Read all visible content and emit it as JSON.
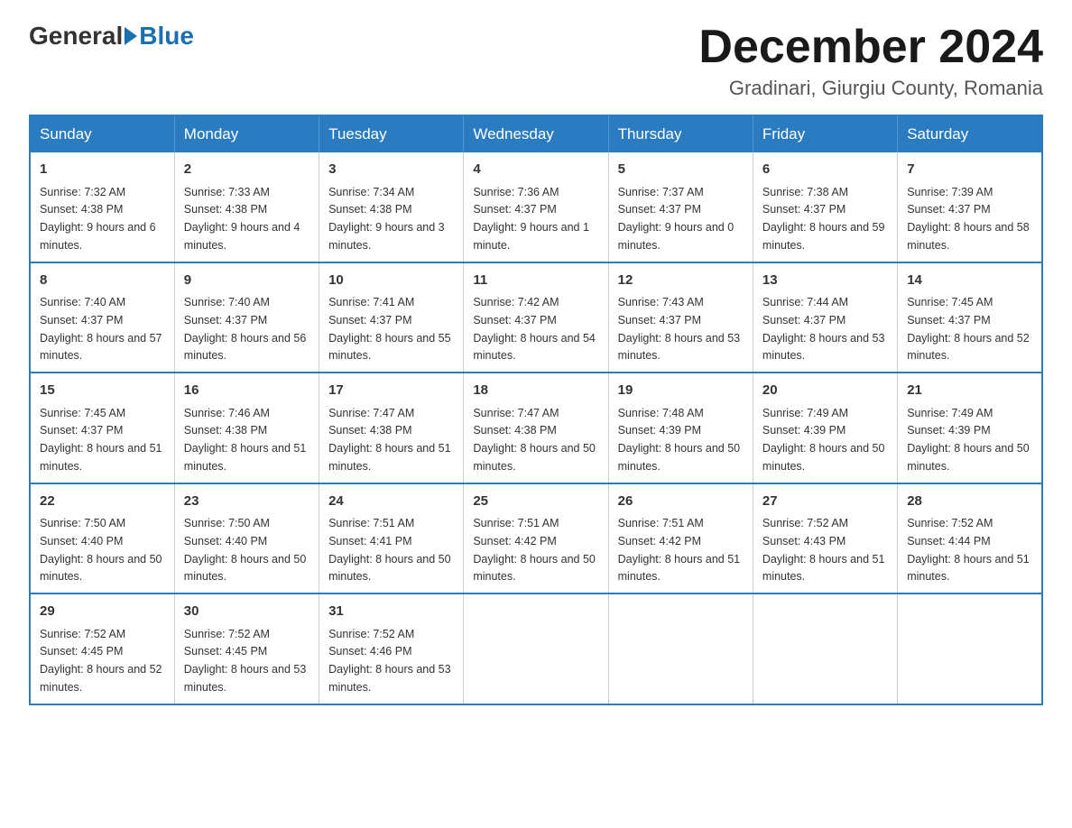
{
  "header": {
    "logo_general": "General",
    "logo_blue": "Blue",
    "month_title": "December 2024",
    "location": "Gradinari, Giurgiu County, Romania"
  },
  "weekdays": [
    "Sunday",
    "Monday",
    "Tuesday",
    "Wednesday",
    "Thursday",
    "Friday",
    "Saturday"
  ],
  "weeks": [
    [
      {
        "day": "1",
        "sunrise": "7:32 AM",
        "sunset": "4:38 PM",
        "daylight": "9 hours and 6 minutes."
      },
      {
        "day": "2",
        "sunrise": "7:33 AM",
        "sunset": "4:38 PM",
        "daylight": "9 hours and 4 minutes."
      },
      {
        "day": "3",
        "sunrise": "7:34 AM",
        "sunset": "4:38 PM",
        "daylight": "9 hours and 3 minutes."
      },
      {
        "day": "4",
        "sunrise": "7:36 AM",
        "sunset": "4:37 PM",
        "daylight": "9 hours and 1 minute."
      },
      {
        "day": "5",
        "sunrise": "7:37 AM",
        "sunset": "4:37 PM",
        "daylight": "9 hours and 0 minutes."
      },
      {
        "day": "6",
        "sunrise": "7:38 AM",
        "sunset": "4:37 PM",
        "daylight": "8 hours and 59 minutes."
      },
      {
        "day": "7",
        "sunrise": "7:39 AM",
        "sunset": "4:37 PM",
        "daylight": "8 hours and 58 minutes."
      }
    ],
    [
      {
        "day": "8",
        "sunrise": "7:40 AM",
        "sunset": "4:37 PM",
        "daylight": "8 hours and 57 minutes."
      },
      {
        "day": "9",
        "sunrise": "7:40 AM",
        "sunset": "4:37 PM",
        "daylight": "8 hours and 56 minutes."
      },
      {
        "day": "10",
        "sunrise": "7:41 AM",
        "sunset": "4:37 PM",
        "daylight": "8 hours and 55 minutes."
      },
      {
        "day": "11",
        "sunrise": "7:42 AM",
        "sunset": "4:37 PM",
        "daylight": "8 hours and 54 minutes."
      },
      {
        "day": "12",
        "sunrise": "7:43 AM",
        "sunset": "4:37 PM",
        "daylight": "8 hours and 53 minutes."
      },
      {
        "day": "13",
        "sunrise": "7:44 AM",
        "sunset": "4:37 PM",
        "daylight": "8 hours and 53 minutes."
      },
      {
        "day": "14",
        "sunrise": "7:45 AM",
        "sunset": "4:37 PM",
        "daylight": "8 hours and 52 minutes."
      }
    ],
    [
      {
        "day": "15",
        "sunrise": "7:45 AM",
        "sunset": "4:37 PM",
        "daylight": "8 hours and 51 minutes."
      },
      {
        "day": "16",
        "sunrise": "7:46 AM",
        "sunset": "4:38 PM",
        "daylight": "8 hours and 51 minutes."
      },
      {
        "day": "17",
        "sunrise": "7:47 AM",
        "sunset": "4:38 PM",
        "daylight": "8 hours and 51 minutes."
      },
      {
        "day": "18",
        "sunrise": "7:47 AM",
        "sunset": "4:38 PM",
        "daylight": "8 hours and 50 minutes."
      },
      {
        "day": "19",
        "sunrise": "7:48 AM",
        "sunset": "4:39 PM",
        "daylight": "8 hours and 50 minutes."
      },
      {
        "day": "20",
        "sunrise": "7:49 AM",
        "sunset": "4:39 PM",
        "daylight": "8 hours and 50 minutes."
      },
      {
        "day": "21",
        "sunrise": "7:49 AM",
        "sunset": "4:39 PM",
        "daylight": "8 hours and 50 minutes."
      }
    ],
    [
      {
        "day": "22",
        "sunrise": "7:50 AM",
        "sunset": "4:40 PM",
        "daylight": "8 hours and 50 minutes."
      },
      {
        "day": "23",
        "sunrise": "7:50 AM",
        "sunset": "4:40 PM",
        "daylight": "8 hours and 50 minutes."
      },
      {
        "day": "24",
        "sunrise": "7:51 AM",
        "sunset": "4:41 PM",
        "daylight": "8 hours and 50 minutes."
      },
      {
        "day": "25",
        "sunrise": "7:51 AM",
        "sunset": "4:42 PM",
        "daylight": "8 hours and 50 minutes."
      },
      {
        "day": "26",
        "sunrise": "7:51 AM",
        "sunset": "4:42 PM",
        "daylight": "8 hours and 51 minutes."
      },
      {
        "day": "27",
        "sunrise": "7:52 AM",
        "sunset": "4:43 PM",
        "daylight": "8 hours and 51 minutes."
      },
      {
        "day": "28",
        "sunrise": "7:52 AM",
        "sunset": "4:44 PM",
        "daylight": "8 hours and 51 minutes."
      }
    ],
    [
      {
        "day": "29",
        "sunrise": "7:52 AM",
        "sunset": "4:45 PM",
        "daylight": "8 hours and 52 minutes."
      },
      {
        "day": "30",
        "sunrise": "7:52 AM",
        "sunset": "4:45 PM",
        "daylight": "8 hours and 53 minutes."
      },
      {
        "day": "31",
        "sunrise": "7:52 AM",
        "sunset": "4:46 PM",
        "daylight": "8 hours and 53 minutes."
      },
      null,
      null,
      null,
      null
    ]
  ],
  "labels": {
    "sunrise": "Sunrise:",
    "sunset": "Sunset:",
    "daylight": "Daylight:"
  }
}
